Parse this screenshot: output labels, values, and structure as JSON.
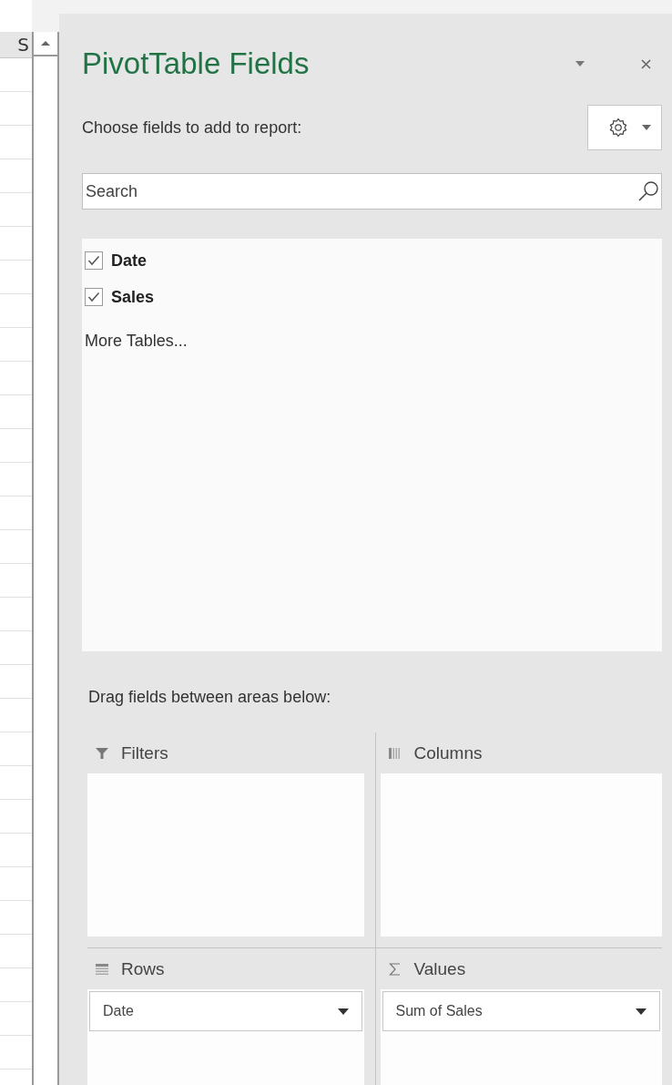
{
  "spreadsheet": {
    "column_header": "S"
  },
  "panel": {
    "title": "PivotTable Fields",
    "subtitle": "Choose fields to add to report:",
    "search": {
      "placeholder": "Search"
    },
    "fields": [
      {
        "label": "Date",
        "checked": true
      },
      {
        "label": "Sales",
        "checked": true
      }
    ],
    "more_tables": "More Tables...",
    "areas_hint": "Drag fields between areas below:",
    "areas": [
      {
        "kind": "filters",
        "label": "Filters"
      },
      {
        "kind": "columns",
        "label": "Columns"
      },
      {
        "kind": "rows",
        "label": "Rows",
        "items": [
          "Date"
        ]
      },
      {
        "kind": "values",
        "label": "Values",
        "items": [
          "Sum of Sales"
        ]
      }
    ]
  }
}
